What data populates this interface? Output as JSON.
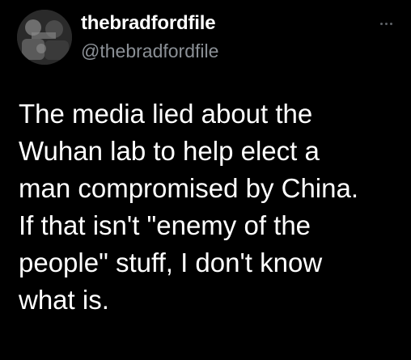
{
  "author": {
    "display_name": "thebradfordfile",
    "handle": "@thebradfordfile"
  },
  "menu": {
    "icon": "more-options-icon"
  },
  "tweet": {
    "lines": [
      "The media lied about the",
      "Wuhan lab to help elect a",
      "man compromised by China.",
      "If that isn't \"enemy of the",
      "people\" stuff, I don't know",
      "what is."
    ]
  },
  "colors": {
    "background": "#000000",
    "text": "#ffffff",
    "handle": "#8b9096"
  }
}
